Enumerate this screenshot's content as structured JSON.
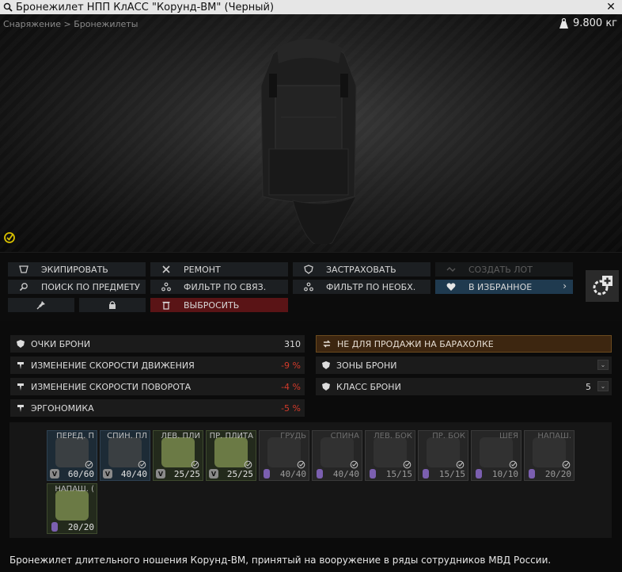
{
  "window": {
    "title": "Бронежилет НПП КлАСС \"Корунд-ВМ\" (Черный)",
    "close": "✕"
  },
  "header": {
    "breadcrumb": "Снаряжение > Бронежилеты",
    "weight": "9.800 кг"
  },
  "actions": {
    "equip": "ЭКИПИРОВАТЬ",
    "repair": "РЕМОНТ",
    "insure": "ЗАСТРАХОВАТЬ",
    "create_offer": "СОЗДАТЬ ЛОТ",
    "search_by_item": "ПОИСК ПО ПРЕДМЕТУ",
    "linked_filter": "ФИЛЬТР ПО СВЯЗ.",
    "required_filter": "ФИЛЬТР ПО НЕОБХ.",
    "favorite": "В ИЗБРАННОЕ",
    "discard": "ВЫБРОСИТЬ"
  },
  "stats": {
    "armor_points_label": "ОЧКИ БРОНИ",
    "armor_points_value": "310",
    "movement_label": "ИЗМЕНЕНИЕ СКОРОСТИ ДВИЖЕНИЯ",
    "movement_value": "-9 %",
    "turn_label": "ИЗМЕНЕНИЕ СКОРОСТИ ПОВОРОТА",
    "turn_value": "-4 %",
    "ergonomics_label": "ЭРГОНОМИКА",
    "ergonomics_value": "-5 %",
    "flea_label": "НЕ ДЛЯ ПРОДАЖИ НА БАРАХОЛКЕ",
    "zones_label": "ЗОНЫ БРОНИ",
    "class_label": "КЛАСС БРОНИ",
    "class_value": "5"
  },
  "slots": [
    {
      "name": "ПЕРЕД. П",
      "count": "60/60",
      "style": "blue",
      "level": "V"
    },
    {
      "name": "СПИН. ПЛ",
      "count": "40/40",
      "style": "blue",
      "level": "V"
    },
    {
      "name": "ЛЕВ. ПЛИ",
      "count": "25/25",
      "style": "green",
      "level": "V"
    },
    {
      "name": "ПР. ПЛИТА",
      "count": "25/25",
      "style": "green",
      "level": "V"
    },
    {
      "name": "ГРУДЬ",
      "count": "40/40",
      "style": "gray",
      "level": ""
    },
    {
      "name": "СПИНА",
      "count": "40/40",
      "style": "gray",
      "level": ""
    },
    {
      "name": "ЛЕВ. БОК",
      "count": "15/15",
      "style": "gray",
      "level": ""
    },
    {
      "name": "ПР. БОК",
      "count": "15/15",
      "style": "gray",
      "level": ""
    },
    {
      "name": "ШЕЯ",
      "count": "10/10",
      "style": "gray",
      "level": ""
    },
    {
      "name": "НАПАШ.",
      "count": "20/20",
      "style": "gray",
      "level": ""
    },
    {
      "name": "НАПАШ. (",
      "count": "20/20",
      "style": "green",
      "level": ""
    }
  ],
  "description": "Бронежилет длительного ношения Корунд-ВМ, принятый на вооружение в ряды сотрудников МВД России.",
  "colors": {
    "accent_orange": "#3d2610",
    "negative": "#d43a2a",
    "favorite_blue": "#1f3a4f",
    "discard_red": "#5a1416"
  }
}
